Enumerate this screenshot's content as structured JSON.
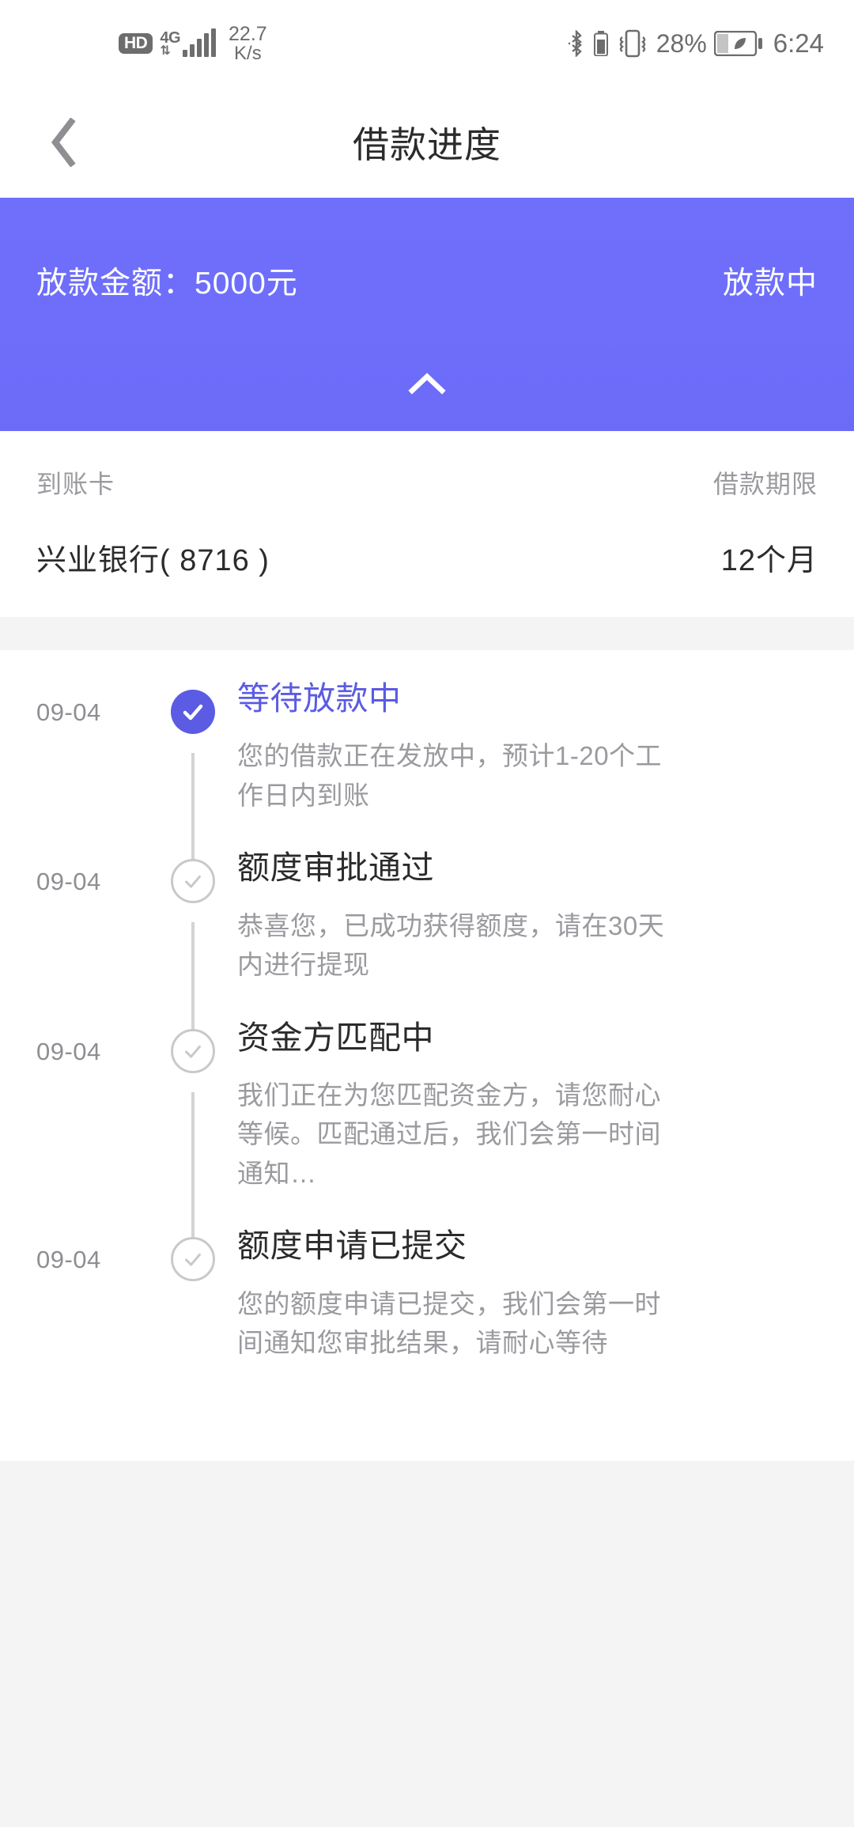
{
  "statusbar": {
    "hd_badge": "HD",
    "network_type": "4G",
    "network_speed_value": "22.7",
    "network_speed_unit": "K/s",
    "battery_percent": "28%",
    "clock": "6:24",
    "icons": [
      "hd-badge",
      "signal-bars-icon",
      "bluetooth-icon",
      "bluetooth-battery-icon",
      "vibrate-icon",
      "battery-saver-icon"
    ]
  },
  "navbar": {
    "title": "借款进度",
    "back_icon": "chevron-left-icon"
  },
  "banner": {
    "amount_label": "放款金额：5000元",
    "status_label": "放款中",
    "collapse_icon": "chevron-up-icon",
    "background_color": "#6e6efb"
  },
  "card_info": {
    "account_card_label": "到账卡",
    "account_card_value": "兴业银行( 8716 )",
    "term_label": "借款期限",
    "term_value": "12个月"
  },
  "timeline": {
    "active_color": "#5b5be3",
    "items": [
      {
        "date": "09-04",
        "title": "等待放款中",
        "desc": "您的借款正在发放中，预计1-20个工作日内到账",
        "state": "active"
      },
      {
        "date": "09-04",
        "title": "额度审批通过",
        "desc": "恭喜您，已成功获得额度，请在30天内进行提现",
        "state": "done"
      },
      {
        "date": "09-04",
        "title": "资金方匹配中",
        "desc": "我们正在为您匹配资金方，请您耐心等候。匹配通过后，我们会第一时间通知…",
        "state": "done"
      },
      {
        "date": "09-04",
        "title": "额度申请已提交",
        "desc": "您的额度申请已提交，我们会第一时间通知您审批结果，请耐心等待",
        "state": "done"
      }
    ]
  }
}
